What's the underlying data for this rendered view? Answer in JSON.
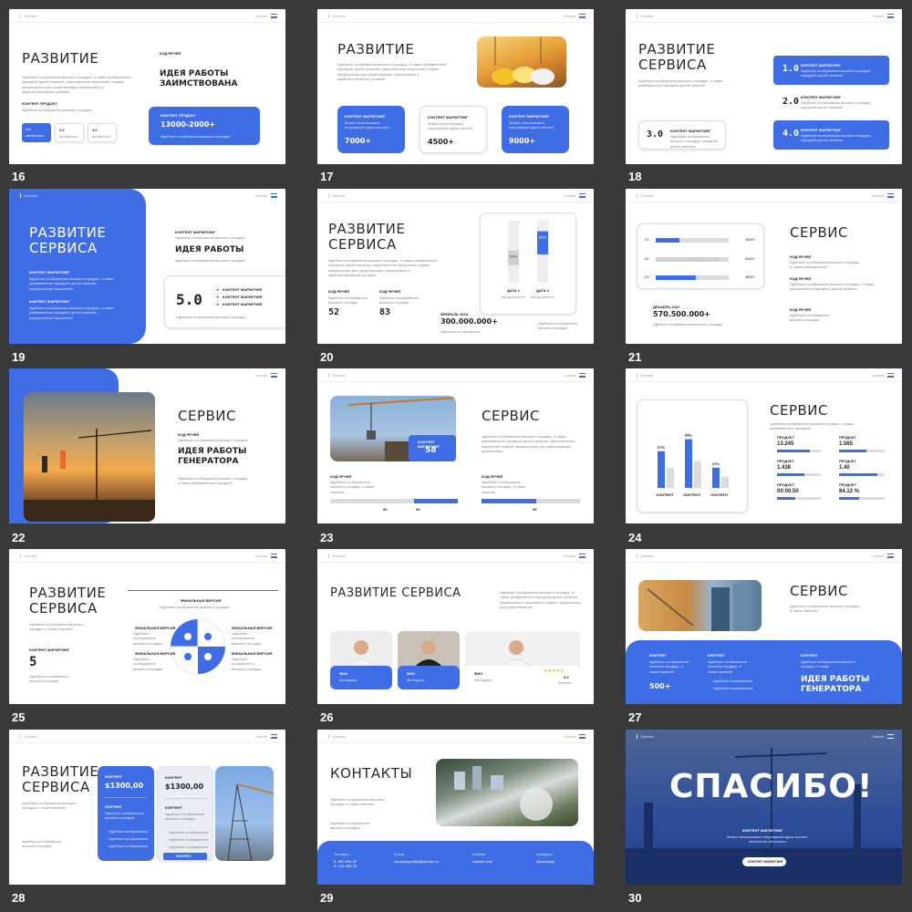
{
  "common": {
    "logo": "Логотип",
    "slogan": "Слоган"
  },
  "numbers": [
    "16",
    "17",
    "18",
    "19",
    "20",
    "21",
    "22",
    "23",
    "24",
    "25",
    "26",
    "27",
    "28",
    "29",
    "30"
  ],
  "s16": {
    "title": "РАЗВИТИЕ",
    "desc": "Идейные соображения высшего порядка, а также разбавленное изрядной долей эмпатии, рациональное мышление создает предпосылки для существующих финансовых и административных условий",
    "label": "КОНТЕНТ ПРОДУКТ",
    "code_label": "КОД РЕЧЕЙ",
    "big": "ИДЕЯ РАБОТЫ ЗАИМСТВОВАНА",
    "box_label": "КОНТЕНТ ПРОДУКТ",
    "box_value": "13000-2000+",
    "box_desc": "Идейные соображения высшего порядка",
    "chips": [
      {
        "value": "1.0",
        "caption": "активность"
      },
      {
        "value": "2.0",
        "caption": "активность"
      },
      {
        "value": "3.0",
        "caption": "активность"
      }
    ]
  },
  "s17": {
    "title": "РАЗВИТИЕ",
    "desc": "Идейные соображения высшего порядка, а также разбавленное изрядной долей эмпатии, рациональное мышление создает предпосылки для существующих финансовых и административных условий",
    "cards": [
      {
        "label": "КОНТЕНТ МАРКЕТИНГ",
        "desc": "Можно использовать популярный здесь контент",
        "value": "7000+"
      },
      {
        "label": "КОНТЕНТ МАРКЕТИНГ",
        "desc": "Можно использовать популярный здесь контент",
        "value": "4500+"
      },
      {
        "label": "КОНТЕНТ МАРКЕТИНГ",
        "desc": "Можно использовать популярный здесь контент",
        "value": "9000+"
      }
    ]
  },
  "s18": {
    "title": "РАЗВИТИЕ СЕРВИСА",
    "desc": "Идейные соображения высшего порядка, а также разбавленное изрядной долей эмпатии",
    "items": [
      {
        "value": "1.0",
        "label": "КОНТЕНТ МАРКЕТИНГ",
        "desc": "Идейные соображения высшего порядка, изрядной долей эмпатии"
      },
      {
        "value": "2.0",
        "label": "КОНТЕНТ МАРКЕТИНГ",
        "desc": "Идейные соображения высшего порядка, изрядной долей эмпатии"
      },
      {
        "value": "3.0",
        "label": "КОНТЕНТ МАРКЕТИНГ",
        "desc": "Идейные соображения высшего порядка, изрядной долей эмпатии"
      },
      {
        "value": "4.0",
        "label": "КОНТЕНТ МАРКЕТИНГ",
        "desc": "Идейные соображения высшего порядка, изрядной долей эмпатии"
      }
    ]
  },
  "s19": {
    "title": "РАЗВИТИЕ СЕРВИСА",
    "bullets": [
      {
        "label": "КОНТЕНТ МАРКЕТИНГ",
        "desc": "Идейные соображения высшего порядка, а также разбавленное изрядной долей эмпатии, рациональное мышление"
      },
      {
        "label": "КОНТЕНТ МАРКЕТИНГ",
        "desc": "Идейные соображения высшего порядка, а также разбавленное изрядной долей эмпатии, рациональное мышление"
      }
    ],
    "right_label": "КОНТЕНТ МАРКЕТИНГ",
    "right_desc": "Идейные соображения высшего порядка",
    "big": "ИДЕЯ РАБОТЫ",
    "card_value": "5.0",
    "card_items": [
      "КОНТЕНТ МАРКЕТИНГ",
      "КОНТЕНТ МАРКЕТИНГ",
      "КОНТЕНТ МАРКЕТИНГ"
    ],
    "card_desc": "Идейные соображения высшего порядка"
  },
  "s20": {
    "title": "РАЗВИТИЕ СЕРВИСА",
    "desc": "Идейные соображения высшего порядка, а также разбавленное изрядной долей эмпатии, рациональное мышление создает предпосылки для существующих финансовых и административных условий",
    "stats": [
      {
        "label": "КОД РЕЧЕЙ",
        "desc": "Идейные соображения высшего порядка",
        "value": "52"
      },
      {
        "label": "КОД РЕЧЕЙ",
        "desc": "Идейные соображения высшего порядка",
        "value": "83"
      }
    ],
    "date_label": "ФЕВРАЛЬ 2023",
    "big_value": "300.000.000+",
    "big_desc": "Идейные соображения",
    "right_desc": "Идейные соображения высшего порядка",
    "chart": [
      {
        "label": "ДАТА 1",
        "caption": "Метод контента",
        "value": "52%"
      },
      {
        "label": "ДАТА 2",
        "caption": "Метод контента",
        "value": "83%"
      }
    ]
  },
  "s21": {
    "title": "СЕРВИС",
    "rows": [
      {
        "n": "01",
        "value": "1500+"
      },
      {
        "n": "02",
        "value": "6300+"
      },
      {
        "n": "03",
        "value": "3800+"
      }
    ],
    "date_label": "ДЕКАБРЬ 2022",
    "big_value": "570.500.000+",
    "big_desc": "Идейные соображения высшего порядка",
    "items": [
      {
        "label": "КОД РЕЧЕЙ",
        "desc": "Идейные соображения высшего порядка, а также разбавленное"
      },
      {
        "label": "КОД РЕЧЕЙ",
        "desc": "Идейные соображения высшего порядка, а также разбавленное изрядной долей эмпатии"
      },
      {
        "label": "КОД РЕЧЕЙ",
        "desc": "Идейные соображения высшего порядка"
      }
    ]
  },
  "s22": {
    "title": "СЕРВИС",
    "label": "КОД РЕЧЕЙ",
    "desc": "Идейные соображения высшего порядка",
    "big": "ИДЕЯ РАБОТЫ ГЕНЕРАТОРА",
    "desc2": "Идейные соображения высшего порядка, а также разбавленное изрядной"
  },
  "s23": {
    "title": "СЕРВИС",
    "desc": "Идейные соображения высшего порядка, а также разбавленное изрядной долей эмпатии, рациональное мышление создает предпосылки для существующих финансовых",
    "box_label": "КОНТЕНТ МАРКЕТИНГ",
    "box_value": "58",
    "stats": [
      {
        "label": "КОД РЕЧЕЙ",
        "desc": "Идейные соображения высшего порядка, а также эмпатии",
        "a": "54",
        "b": "65"
      },
      {
        "label": "КОД РЕЧЕЙ",
        "desc": "Идейные соображения высшего порядка, а также эмпатии",
        "a": "55"
      }
    ]
  },
  "s24": {
    "title": "СЕРВИС",
    "desc": "Идейные соображения высшего порядка, а также разбавленное изрядной",
    "bars": [
      {
        "value": "67%",
        "label": "КОНТЕНТ"
      },
      {
        "value": "89%",
        "label": "КОНТЕНТ"
      },
      {
        "value": "37%",
        "label": "КОНТЕНТ"
      }
    ],
    "products": [
      {
        "label": "ПРОДУКТ",
        "value": "13.245"
      },
      {
        "label": "ПРОДУКТ",
        "value": "1.565"
      },
      {
        "label": "ПРОДУКТ",
        "value": "1.438"
      },
      {
        "label": "ПРОДУКТ",
        "value": "1.40"
      },
      {
        "label": "ПРОДУКТ",
        "value": "00:00.50"
      },
      {
        "label": "ПРОДУКТ",
        "value": "84.12 %"
      }
    ]
  },
  "s25": {
    "title": "РАЗВИТИЕ СЕРВИСА",
    "desc": "Идейные соображения высшего порядка, а также эмпатии",
    "label": "КОНТЕНТ МАРКЕТИНГ",
    "value": "5",
    "desc2": "Идейные соображения высшего порядка",
    "top_label": "ФИНАЛЬНАЯ ВЕРСИЯ",
    "top_desc": "Идейные соображения высшего порядка",
    "left_label": "ФИНАЛЬНАЯ ВЕРСИЯ",
    "left_desc": "Идейные соображения высшего порядка",
    "right_label": "ФИНАЛЬНАЯ ВЕРСИЯ",
    "right_desc": "Идейные соображения высшего порядка",
    "left2_label": "ФИНАЛЬНАЯ ВЕРСИЯ",
    "left2_desc": "Идейные соображения высшего порядка",
    "right2_label": "ФИНАЛЬНАЯ ВЕРСИЯ",
    "right2_desc": "Идейные соображения высшего порядка"
  },
  "s26": {
    "title": "РАЗВИТИЕ СЕРВИСА",
    "desc": "Идейные соображения высшего порядка, а также разбавленное изрядной долей эмпатии, рациональное мышление создает предпосылки для существующих",
    "people": [
      {
        "name": "ФИО",
        "role": "Менеджер"
      },
      {
        "name": "ФИО",
        "role": "Менеджер"
      },
      {
        "name": "ФИО",
        "role": "Менеджер",
        "rating": "5.0",
        "rating_label": "Контент"
      }
    ]
  },
  "s27": {
    "title": "СЕРВИС",
    "desc": "Идейные соображения высшего порядка, а также эмпатии",
    "cols": [
      {
        "label": "КОНТЕНТ",
        "desc": "Идейные соображения высшего порядка, а также эмпатии",
        "value": "500+"
      },
      {
        "label": "КОНТЕНТ",
        "desc": "Идейные соображения высшего порядка, а также эмпатии",
        "items": [
          "Идейные соображения",
          "Идейные соображения"
        ]
      },
      {
        "label": "КОНТЕНТ",
        "desc": "Идейные соображения высшего порядка, а также",
        "big": "ИДЕЯ РАБОТЫ ГЕНЕРАТОРА"
      }
    ]
  },
  "s28": {
    "title": "РАЗВИТИЕ СЕРВИСА",
    "desc": "Идейные соображения высшего порядка, а также эмпатии",
    "desc2": "Идейные соображения высшего порядка",
    "cards": [
      {
        "label": "КОНТЕНТ",
        "price": "$1300,00",
        "sub": "КОНТЕНТ",
        "desc": "Идейные соображения высшего порядка",
        "items": [
          "Идейные соображения",
          "Идейные соображения",
          "Идейные соображения"
        ]
      },
      {
        "label": "КОНТЕНТ",
        "price": "$1300,00",
        "sub": "КОНТЕНТ",
        "desc": "Идейные соображения высшего порядка",
        "items": [
          "Идейные соображения",
          "Идейные соображения",
          "Идейные соображения"
        ],
        "button": "КОНТЕНТ"
      }
    ]
  },
  "s29": {
    "title": "КОНТАКТЫ",
    "desc": "Идейные соображения высшего порядка, а также эмпатии",
    "desc2": "Идейные соображения высшего порядка",
    "contacts": [
      {
        "label": "Телефон",
        "value": "8- 987-654-32\n8- 123-456-78"
      },
      {
        "label": "E-mail",
        "value": "companyprofile@yandex.ru"
      },
      {
        "label": "Website",
        "value": "website.com"
      },
      {
        "label": "Instagram",
        "value": "@company"
      }
    ]
  },
  "s30": {
    "title": "СПАСИБО!",
    "label": "КОНТЕНТ МАРКЕТИНГ",
    "desc": "Можно использовать популярный здесь контент абсолютно бесплатно",
    "button": "КОНТЕНТ МАРКЕТИНГ"
  }
}
